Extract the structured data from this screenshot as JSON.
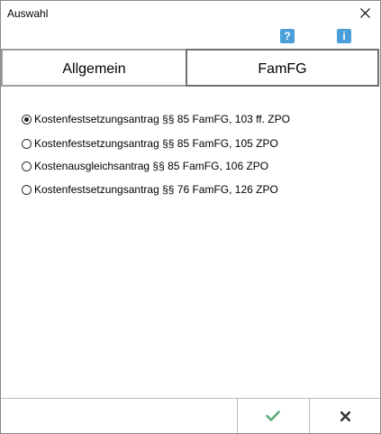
{
  "window": {
    "title": "Auswahl"
  },
  "toolbar": {
    "help_label": "?",
    "info_label": "i"
  },
  "tabs": [
    {
      "label": "Allgemein",
      "selected": false
    },
    {
      "label": "FamFG",
      "selected": true
    }
  ],
  "options": [
    {
      "label": "Kostenfestsetzungsantrag §§ 85 FamFG, 103 ff. ZPO",
      "checked": true
    },
    {
      "label": "Kostenfestsetzungsantrag §§ 85 FamFG, 105 ZPO",
      "checked": false
    },
    {
      "label": "Kostenausgleichsantrag §§ 85 FamFG, 106 ZPO",
      "checked": false
    },
    {
      "label": "Kostenfestsetzungsantrag §§ 76 FamFG, 126 ZPO",
      "checked": false
    }
  ],
  "icons": {
    "ok": "checkmark-icon",
    "cancel": "cross-icon",
    "close": "close-icon",
    "help": "help-icon",
    "info": "info-icon"
  },
  "colors": {
    "accent_blue": "#4a9fd8",
    "ok_green": "#5cab7d",
    "cancel_dark": "#333333"
  }
}
